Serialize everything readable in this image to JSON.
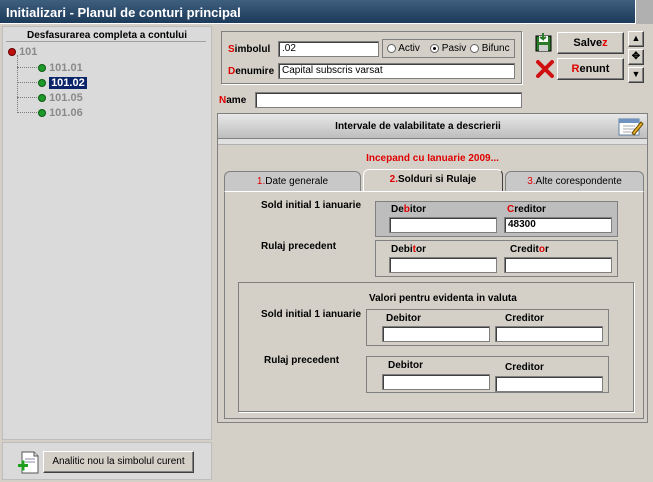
{
  "window": {
    "title": "Initializari - Planul de conturi principal"
  },
  "tree": {
    "header": "Desfasurarea completa a contului",
    "root": "101",
    "children": [
      "101.01",
      "101.02",
      "101.05",
      "101.06"
    ],
    "selected": "101.02"
  },
  "bottom_button": {
    "label": "Analitic nou la simbolul curent"
  },
  "form": {
    "simbol_label_first": "S",
    "simbol_label_rest": "imbolul",
    "simbol_value": ".02",
    "radio_activ": "Activ",
    "radio_pasiv": "Pasiv",
    "radio_bifunc": "Bifunc",
    "radio_selected": "Pasiv",
    "denumire_label_first": "D",
    "denumire_label_rest": "enumire",
    "denumire_value": "Capital subscris varsat",
    "name_label_first": "N",
    "name_label_rest": "ame",
    "name_value": ""
  },
  "actions": {
    "save_pre": "Salve",
    "save_hot": "z",
    "cancel_hot": "R",
    "cancel_post": "enunt"
  },
  "validity": {
    "header": "Intervale de valabilitate a descrierii",
    "period": "Incepand cu Ianuarie 2009..."
  },
  "tabs": [
    {
      "num": "1.",
      "label": "Date generale"
    },
    {
      "num": "2.",
      "label": "Solduri si Rulaje"
    },
    {
      "num": "3.",
      "label": "Alte corespondente"
    }
  ],
  "balances": {
    "sold_label": "Sold initial 1 ianuarie",
    "rulaj_label": "Rulaj precedent",
    "sold_debitor_a": "De",
    "sold_debitor_b": "b",
    "sold_debitor_c": "itor",
    "sold_creditor_a": "C",
    "sold_creditor_b": "reditor",
    "sold_debitor_value": "",
    "sold_creditor_value": "48300",
    "rulaj_debitor_a": "Debi",
    "rulaj_debitor_b": "t",
    "rulaj_debitor_c": "or",
    "rulaj_creditor_a": "Credit",
    "rulaj_creditor_b": "o",
    "rulaj_creditor_c": "r",
    "rulaj_debitor_value": "",
    "rulaj_creditor_value": ""
  },
  "currency": {
    "title": "Valori pentru evidenta in valuta",
    "sold_label": "Sold initial 1 ianuarie",
    "rulaj_label": "Rulaj precedent",
    "debitor": "Debitor",
    "creditor": "Creditor"
  }
}
